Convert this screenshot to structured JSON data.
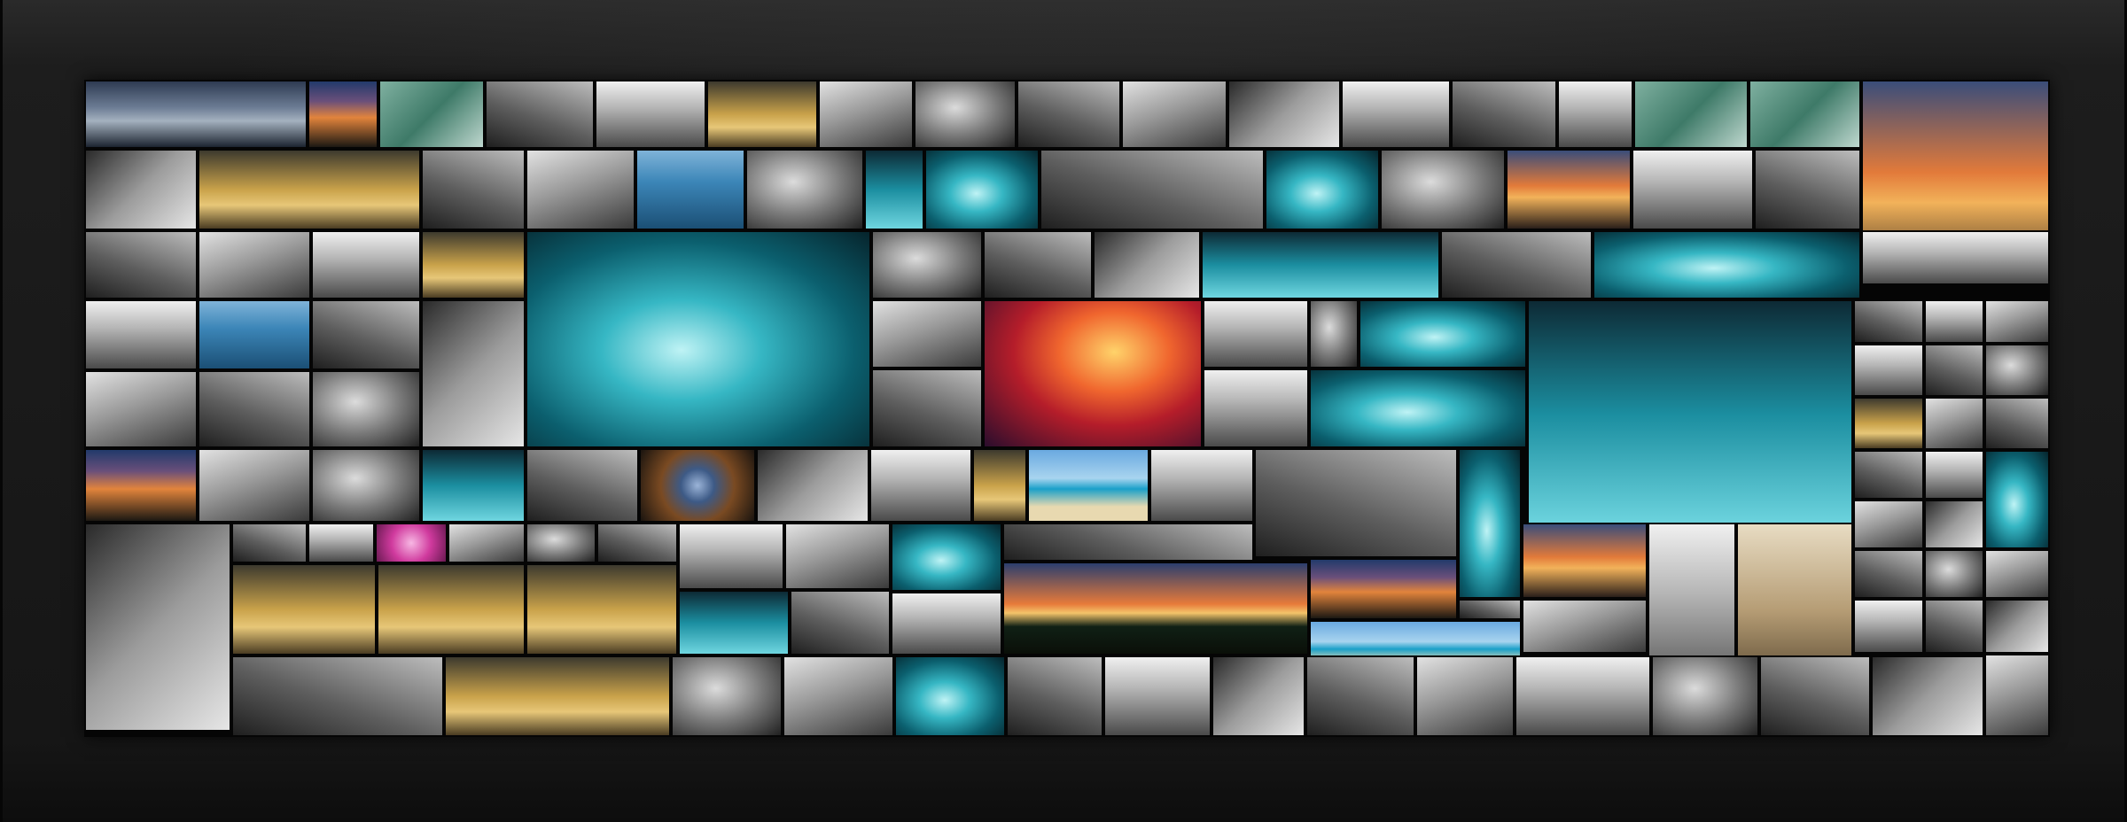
{
  "artwork": {
    "subject": "photo-mosaic-collage",
    "frame_color": "#1a1a1a",
    "palette": {
      "ocean_teal": "#1f8fa0",
      "deep_teal": "#0b5563",
      "sunset_orange": "#e0782a",
      "gold": "#c9a24a",
      "lava_red": "#d6392a",
      "magenta": "#c2328f",
      "bw_light": "#cfcfcf",
      "bw_mid": "#8a8a8a",
      "bw_dark": "#3a3a3a"
    }
  }
}
